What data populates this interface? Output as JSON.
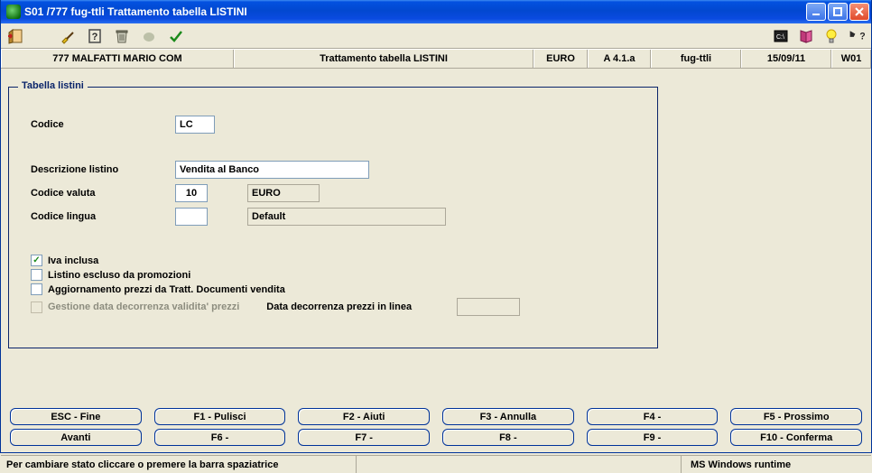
{
  "window": {
    "title": "S01 /777 fug-ttli Trattamento tabella LISTINI"
  },
  "inforow": {
    "user": "777 MALFATTI MARIO  COM",
    "title": "Trattamento tabella LISTINI",
    "currency": "EURO",
    "version": "A 4.1.a",
    "module": "fug-ttli",
    "date": "15/09/11",
    "workstation": "W01"
  },
  "group": {
    "legend": "Tabella listini"
  },
  "fields": {
    "codice_label": "Codice",
    "codice_value": "LC",
    "descrizione_label": "Descrizione listino",
    "descrizione_value": "Vendita al Banco",
    "valuta_label": "Codice   valuta",
    "valuta_code": "10",
    "valuta_desc": "EURO",
    "lingua_label": "Codice   lingua",
    "lingua_code": "",
    "lingua_desc": "Default",
    "decorrenza_label": "Data decorrenza prezzi in linea",
    "decorrenza_value": ""
  },
  "checks": {
    "iva": "Iva inclusa",
    "promo": "Listino escluso da promozioni",
    "agg": "Aggiornamento prezzi da Tratt. Documenti vendita",
    "gest": "Gestione data decorrenza validita' prezzi"
  },
  "checks_state": {
    "iva_checked": "✓"
  },
  "fnkeys": {
    "esc": "ESC - Fine",
    "f1": "F1 - Pulisci",
    "f2": "F2 -  Aiuti",
    "f3": "F3 - Annulla",
    "f4": "F4 -",
    "f5": "F5 - Prossimo",
    "avanti": "Avanti",
    "f6": "F6 -",
    "f7": "F7 -",
    "f8": "F8 -",
    "f9": "F9 -",
    "f10": "F10 - Conferma"
  },
  "status": {
    "left": "Per cambiare stato cliccare o premere la barra spaziatrice",
    "right": "MS Windows runtime"
  }
}
